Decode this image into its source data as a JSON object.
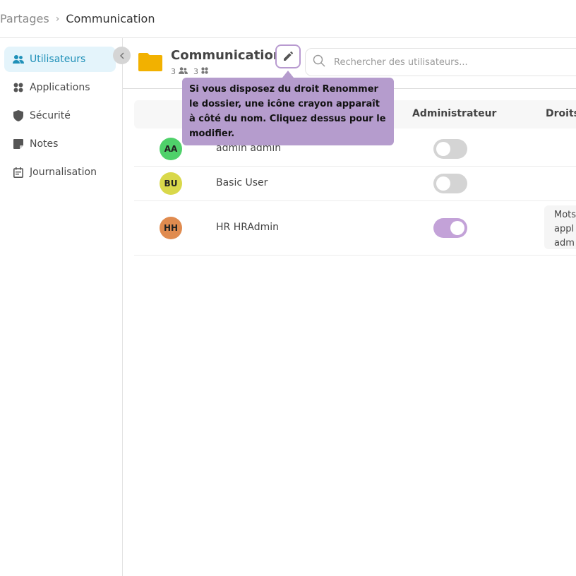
{
  "breadcrumb": {
    "root": "Partages",
    "separator": "›",
    "current": "Communication"
  },
  "sidebar": {
    "items": [
      {
        "label": "Utilisateurs",
        "icon": "users-icon",
        "active": true
      },
      {
        "label": "Applications",
        "icon": "apps-grid-icon",
        "active": false
      },
      {
        "label": "Sécurité",
        "icon": "shield-icon",
        "active": false
      },
      {
        "label": "Notes",
        "icon": "note-icon",
        "active": false
      },
      {
        "label": "Journalisation",
        "icon": "calendar-log-icon",
        "active": false
      }
    ]
  },
  "folder": {
    "name": "Communication",
    "users_count": "3",
    "apps_count": "3",
    "icon_color": "#f2b100"
  },
  "search": {
    "placeholder": "Rechercher des utilisateurs..."
  },
  "tooltip": {
    "text": "Si vous disposez du droit Renommer le dossier, une icône crayon apparaît à côté du nom. Cliquez dessus pour le modifier."
  },
  "table": {
    "headers": {
      "admin": "Administrateur",
      "rights": "Droits"
    },
    "rows": [
      {
        "initials": "AA",
        "name": "admin admin",
        "avatar_color": "#4fd16a",
        "admin": false,
        "rights": ""
      },
      {
        "initials": "BU",
        "name": "Basic User",
        "avatar_color": "#d9d84a",
        "admin": false,
        "rights": ""
      },
      {
        "initials": "HH",
        "name": "HR HRAdmin",
        "avatar_color": "#e08b4f",
        "admin": true,
        "rights_lines": [
          "Mots",
          "appl",
          "adm"
        ]
      }
    ]
  },
  "colors": {
    "accent": "#1f90b8",
    "tooltip": "#b59ccd",
    "toggle_on": "#c3a2d8"
  }
}
